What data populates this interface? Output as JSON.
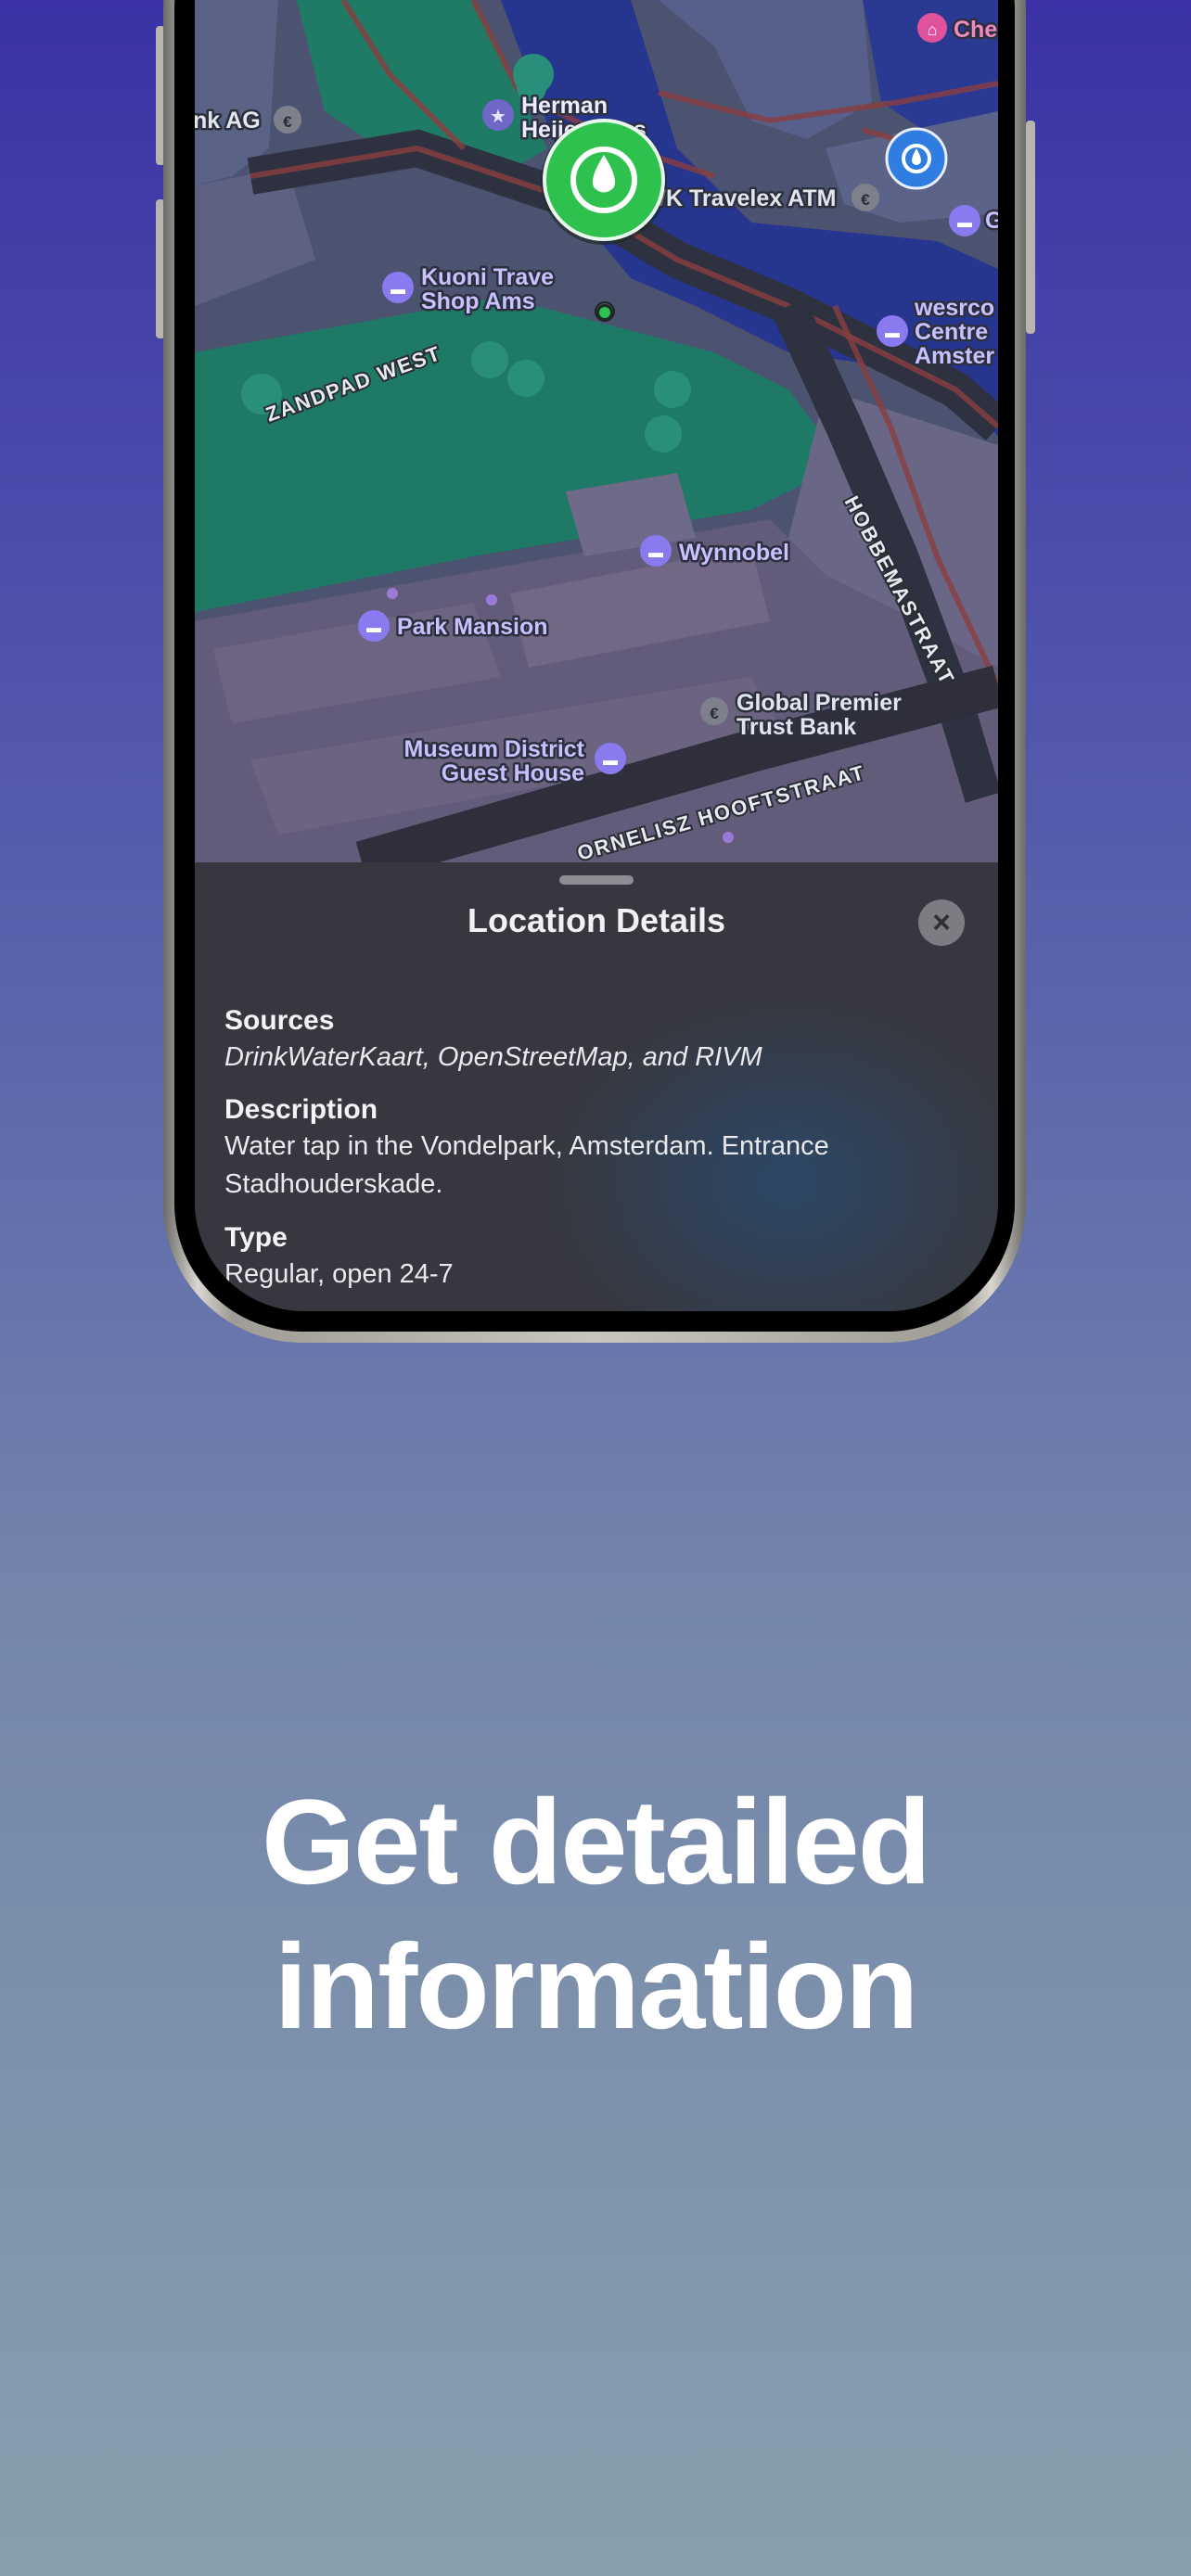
{
  "sheet": {
    "title": "Location Details",
    "close_icon": "xmark-icon",
    "sources_label": "Sources",
    "sources_value": "DrinkWaterKaart, OpenStreetMap, and RIVM",
    "description_label": "Description",
    "description_value": "Water tap in the Vondelpark, Amsterdam. Entrance Stadhouderskade.",
    "type_label": "Type",
    "type_value": "Regular, open 24-7"
  },
  "map": {
    "labels": {
      "bank_ag": "nk AG",
      "herman_1": "Herman",
      "herman_2": "Heijermans",
      "gwk": "GWK Travelex ATM",
      "kuoni_1": "Kuoni Trave",
      "kuoni_2": "Shop Ams",
      "wesrco_1": "wesrco",
      "wesrco_2": "Centre",
      "wesrco_3": "Amster",
      "che": "Che",
      "g_partial": "G",
      "wynnobel": "Wynnobel",
      "park_mansion": "Park Mansion",
      "global_1": "Global Premier",
      "global_2": "Trust Bank",
      "museum_1": "Museum District",
      "museum_2": "Guest House",
      "zandpad": "ZANDPAD WEST",
      "hobbemastraat": "HOBBEMASTRAAT",
      "hooftstraat": "ORNELISZ HOOFTSTRAAT"
    },
    "icons": {
      "selected_pin": "water-drop-icon",
      "secondary_pin": "water-drop-icon",
      "hotel": "bed-icon",
      "bank": "bank-icon",
      "landmark": "star-icon",
      "museum": "museum-icon"
    },
    "colors": {
      "selected_pin": "#2fc14e",
      "secondary_pin": "#2f7de0",
      "hotel_poi": "#8a7af0",
      "park": "#1e7a67",
      "water": "#26358e"
    }
  },
  "headline": {
    "line1": "Get detailed",
    "line2": "information"
  }
}
